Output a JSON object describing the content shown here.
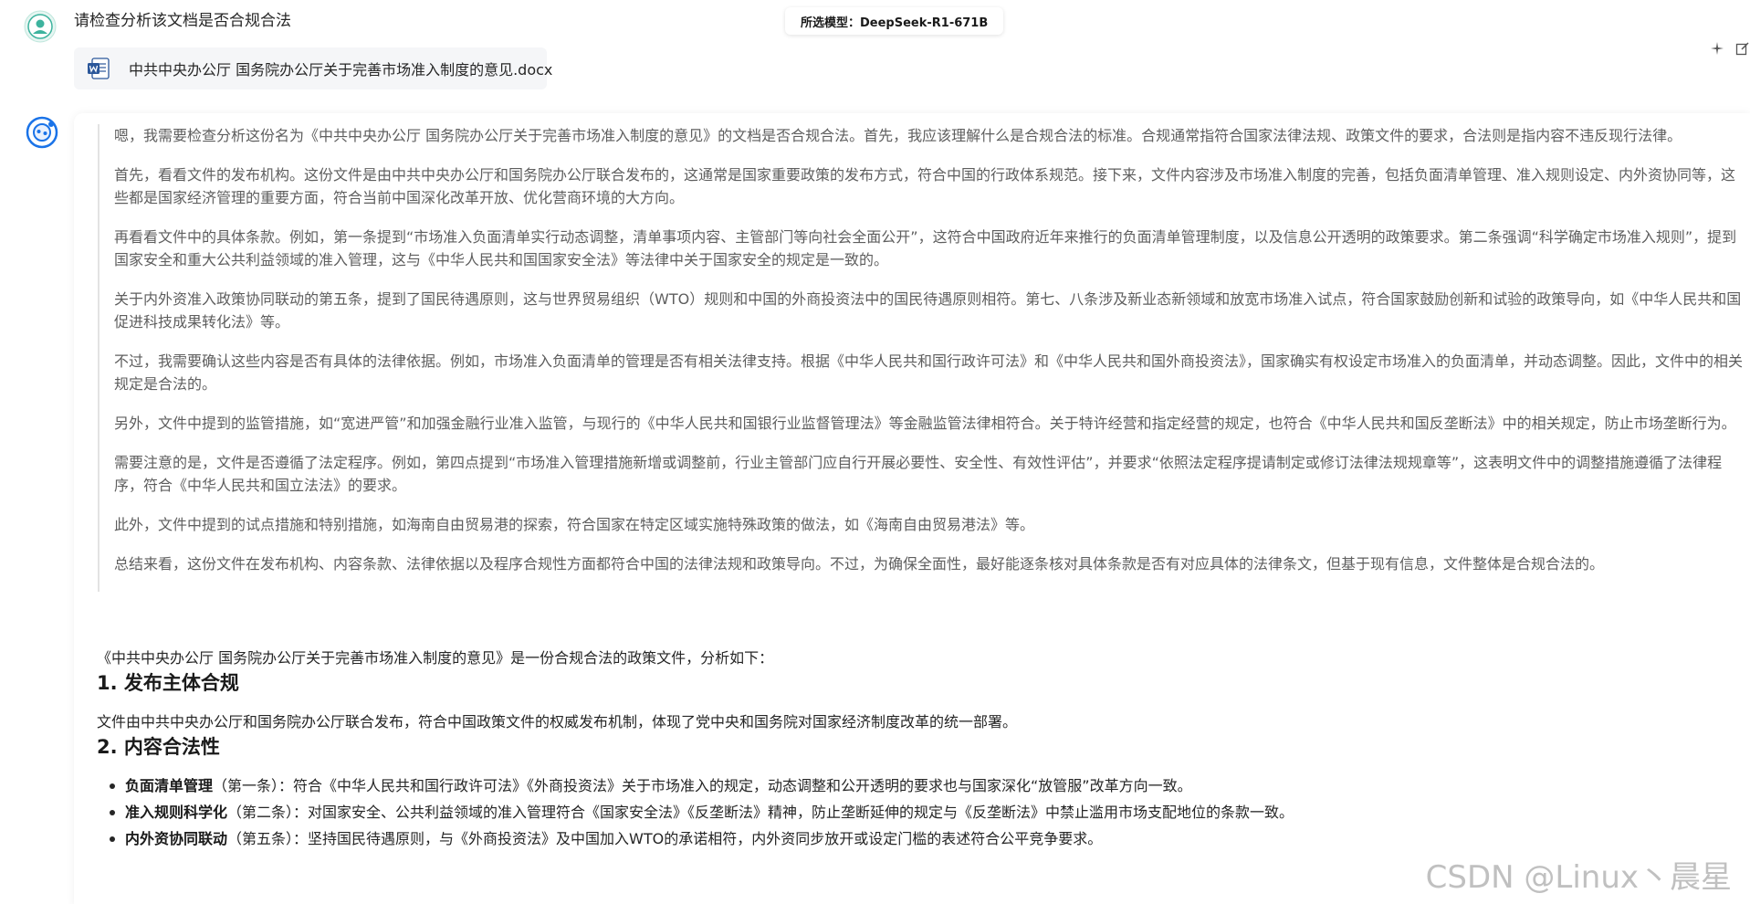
{
  "user": {
    "message": "请检查分析该文档是否合规合法"
  },
  "model": {
    "label": "所选模型：DeepSeek-R1-671B"
  },
  "file": {
    "name": "中共中央办公厅 国务院办公厅关于完善市场准入制度的意见.docx",
    "icon": "word-doc-icon",
    "accent": "#2b579a"
  },
  "thinking": [
    "嗯，我需要检查分析这份名为《中共中央办公厅 国务院办公厅关于完善市场准入制度的意见》的文档是否合规合法。首先，我应该理解什么是合规合法的标准。合规通常指符合国家法律法规、政策文件的要求，合法则是指内容不违反现行法律。",
    "首先，看看文件的发布机构。这份文件是由中共中央办公厅和国务院办公厅联合发布的，这通常是国家重要政策的发布方式，符合中国的行政体系规范。接下来，文件内容涉及市场准入制度的完善，包括负面清单管理、准入规则设定、内外资协同等，这些都是国家经济管理的重要方面，符合当前中国深化改革开放、优化营商环境的大方向。",
    "再看看文件中的具体条款。例如，第一条提到“市场准入负面清单实行动态调整，清单事项内容、主管部门等向社会全面公开”，这符合中国政府近年来推行的负面清单管理制度，以及信息公开透明的政策要求。第二条强调“科学确定市场准入规则”，提到国家安全和重大公共利益领域的准入管理，这与《中华人民共和国国家安全法》等法律中关于国家安全的规定是一致的。",
    "关于内外资准入政策协同联动的第五条，提到了国民待遇原则，这与世界贸易组织（WTO）规则和中国的外商投资法中的国民待遇原则相符。第七、八条涉及新业态新领域和放宽市场准入试点，符合国家鼓励创新和试验的政策导向，如《中华人民共和国促进科技成果转化法》等。",
    "不过，我需要确认这些内容是否有具体的法律依据。例如，市场准入负面清单的管理是否有相关法律支持。根据《中华人民共和国行政许可法》和《中华人民共和国外商投资法》，国家确实有权设定市场准入的负面清单，并动态调整。因此，文件中的相关规定是合法的。",
    "另外，文件中提到的监管措施，如“宽进严管”和加强金融行业准入监管，与现行的《中华人民共和国银行业监督管理法》等金融监管法律相符合。关于特许经营和指定经营的规定，也符合《中华人民共和国反垄断法》中的相关规定，防止市场垄断行为。",
    "需要注意的是，文件是否遵循了法定程序。例如，第四点提到“市场准入管理措施新增或调整前，行业主管部门应自行开展必要性、安全性、有效性评估”，并要求“依照法定程序提请制定或修订法律法规规章等”，这表明文件中的调整措施遵循了法律程序，符合《中华人民共和国立法法》的要求。",
    "此外，文件中提到的试点措施和特别措施，如海南自由贸易港的探索，符合国家在特定区域实施特殊政策的做法，如《海南自由贸易港法》等。",
    "总结来看，这份文件在发布机构、内容条款、法律依据以及程序合规性方面都符合中国的法律法规和政策导向。不过，为确保全面性，最好能逐条核对具体条款是否有对应具体的法律条文，但基于现有信息，文件整体是合规合法的。"
  ],
  "answer": {
    "intro": "《中共中央办公厅 国务院办公厅关于完善市场准入制度的意见》是一份合规合法的政策文件，分析如下：",
    "section1_title": "1. 发布主体合规",
    "section1_body": "文件由中共中央办公厅和国务院办公厅联合发布，符合中国政策文件的权威发布机制，体现了党中央和国务院对国家经济制度改革的统一部署。",
    "section2_title": "2. 内容合法性",
    "bullets": [
      {
        "term": "负面清单管理",
        "rest": "（第一条）：符合《中华人民共和国行政许可法》《外商投资法》关于市场准入的规定，动态调整和公开透明的要求也与国家深化“放管服”改革方向一致。"
      },
      {
        "term": "准入规则科学化",
        "rest": "（第二条）：对国家安全、公共利益领域的准入管理符合《国家安全法》《反垄断法》精神，防止垄断延伸的规定与《反垄断法》中禁止滥用市场支配地位的条款一致。"
      },
      {
        "term": "内外资协同联动",
        "rest": "（第五条）：坚持国民待遇原则，与《外商投资法》及中国加入WTO的承诺相符，内外资同步放开或设定门槛的表述符合公平竞争要求。"
      }
    ]
  },
  "watermark": "CSDN @Linux丶晨星",
  "colors": {
    "avatar_green": "#3db39e",
    "ai_blue": "#1a73e8",
    "think_text": "#5e5e5e"
  }
}
